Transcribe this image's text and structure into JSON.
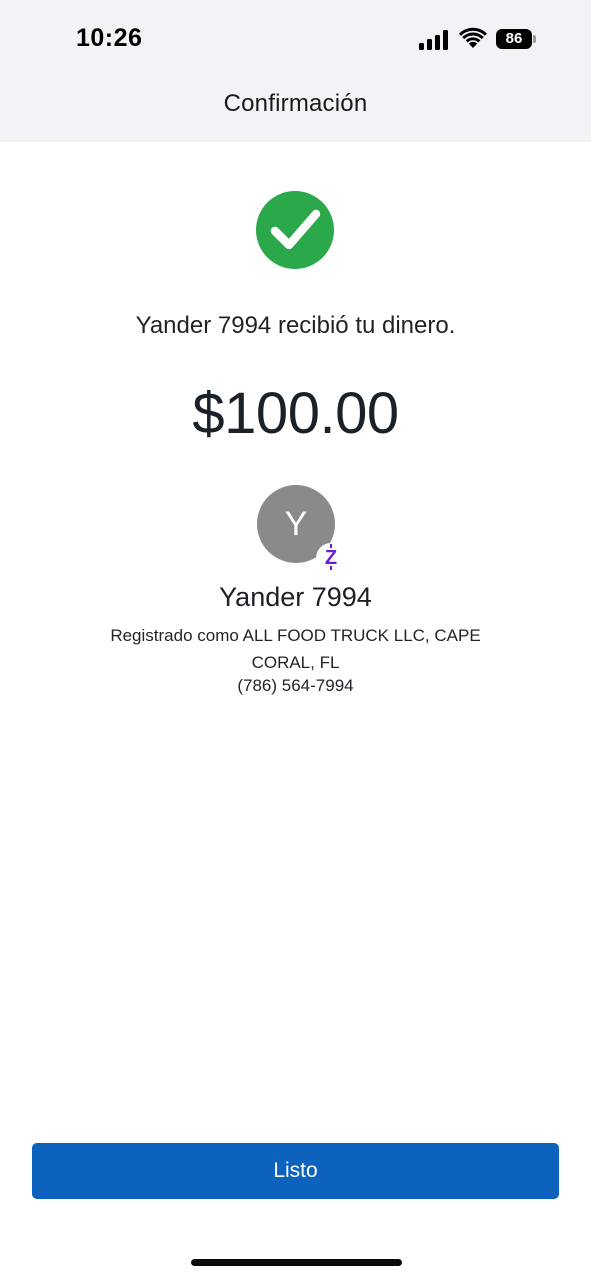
{
  "status_bar": {
    "time": "10:26",
    "battery_level": "86",
    "icons": [
      "signal-icon",
      "wifi-icon",
      "battery-icon"
    ]
  },
  "header": {
    "title": "Confirmación"
  },
  "confirmation": {
    "status_icon": "checkmark-circle-icon",
    "status_color": "#2aa84a",
    "message": "Yander 7994 recibió tu dinero.",
    "amount": "$100.00"
  },
  "recipient": {
    "avatar_initial": "Y",
    "badge_icon": "zelle-icon",
    "badge_glyph": "Z",
    "badge_color": "#6c1cd3",
    "name": "Yander 7994",
    "registered_as": "Registrado como ALL FOOD TRUCK LLC, CAPE CORAL, FL",
    "phone": "(786) 564-7994"
  },
  "actions": {
    "done_label": "Listo",
    "button_color": "#0d62bd"
  }
}
